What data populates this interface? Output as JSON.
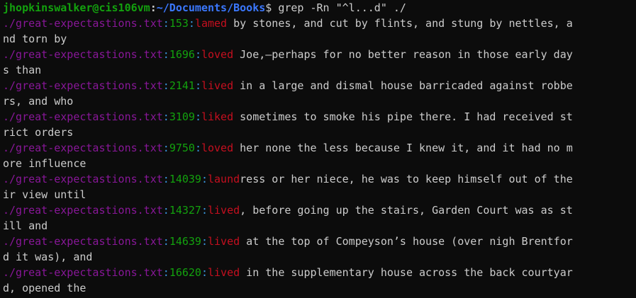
{
  "prompt": {
    "user_host": "jhopkinswalker@cis106vm",
    "separator": ":",
    "path": "~/Documents/Books",
    "dollar": "$",
    "command": " grep -Rn \"^l...d\" ./"
  },
  "results": [
    {
      "file": "./great-expectastions.txt",
      "line": "153",
      "match": "lamed",
      "rest": " by stones, and cut by flints, and stung by nettles, a",
      "cont": "nd torn by"
    },
    {
      "file": "./great-expectastions.txt",
      "line": "1696",
      "match": "loved",
      "rest": " Joe,—perhaps for no better reason in those early day",
      "cont": "s than"
    },
    {
      "file": "./great-expectastions.txt",
      "line": "2141",
      "match": "lived",
      "rest": " in a large and dismal house barricaded against robbe",
      "cont": "rs, and who"
    },
    {
      "file": "./great-expectastions.txt",
      "line": "3109",
      "match": "liked",
      "rest": " sometimes to smoke his pipe there. I had received st",
      "cont": "rict orders"
    },
    {
      "file": "./great-expectastions.txt",
      "line": "9750",
      "match": "loved",
      "rest": " her none the less because I knew it, and it had no m",
      "cont": "ore influence"
    },
    {
      "file": "./great-expectastions.txt",
      "line": "14039",
      "match": "laund",
      "rest": "ress or her niece, he was to keep himself out of the",
      "cont": "ir view until"
    },
    {
      "file": "./great-expectastions.txt",
      "line": "14327",
      "match": "lived",
      "rest": ", before going up the stairs, Garden Court was as st",
      "cont": "ill and"
    },
    {
      "file": "./great-expectastions.txt",
      "line": "14639",
      "match": "lived",
      "rest": " at the top of Compeyson’s house (over nigh Brentfor",
      "cont": "d it was), and"
    },
    {
      "file": "./great-expectastions.txt",
      "line": "16620",
      "match": "lived",
      "rest": " in the supplementary house across the back courtyar",
      "cont": "d, opened the"
    }
  ]
}
